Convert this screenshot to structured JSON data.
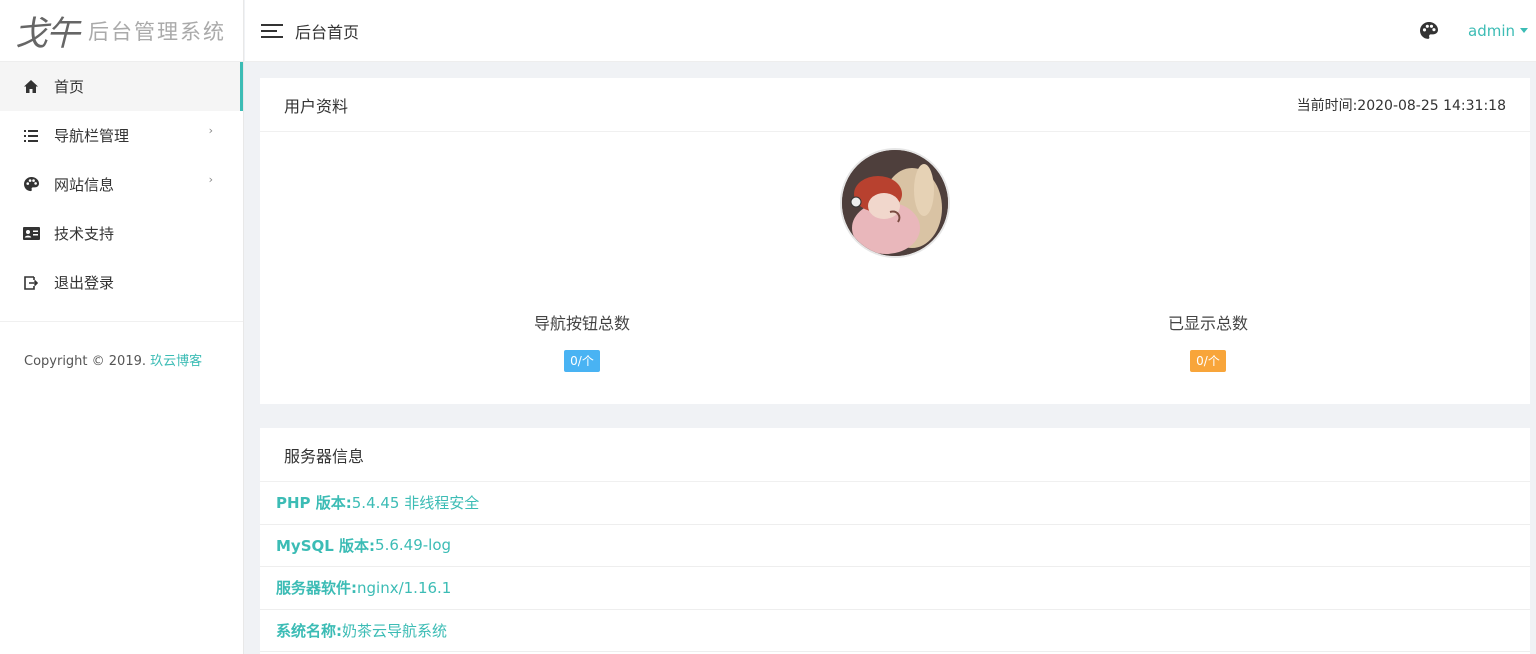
{
  "app": {
    "logo_mark": "戈午",
    "logo_text": "后台管理系统"
  },
  "sidebar": {
    "items": [
      {
        "label": "首页",
        "icon": "home-icon",
        "active": true
      },
      {
        "label": "导航栏管理",
        "icon": "list-icon",
        "has_arrow": true
      },
      {
        "label": "网站信息",
        "icon": "palette-icon",
        "has_arrow": true
      },
      {
        "label": "技术支持",
        "icon": "id-card-icon"
      },
      {
        "label": "退出登录",
        "icon": "logout-icon"
      }
    ],
    "arrow_glyph": "›",
    "copyright_text": "Copyright © 2019.",
    "copyright_link": "玖云博客"
  },
  "header": {
    "title": "后台首页",
    "user": "admin"
  },
  "profile_card": {
    "title": "用户资料",
    "time": "当前时间:2020-08-25 14:31:18",
    "stats": [
      {
        "label": "导航按钮总数",
        "value": "0/个",
        "color": "#49b3f3"
      },
      {
        "label": "已显示总数",
        "value": "0/个",
        "color": "#f8a53a"
      }
    ]
  },
  "server_card": {
    "title": "服务器信息",
    "rows": [
      {
        "key": "PHP 版本:",
        "value": "5.4.45 非线程安全"
      },
      {
        "key": "MySQL 版本:",
        "value": "5.6.49-log"
      },
      {
        "key": "服务器软件:",
        "value": "nginx/1.16.1"
      },
      {
        "key": "系统名称:",
        "value": "奶茶云导航系统"
      }
    ]
  },
  "colors": {
    "accent": "#3cbcb5",
    "badge_blue": "#49b3f3",
    "badge_orange": "#f8a53a"
  }
}
